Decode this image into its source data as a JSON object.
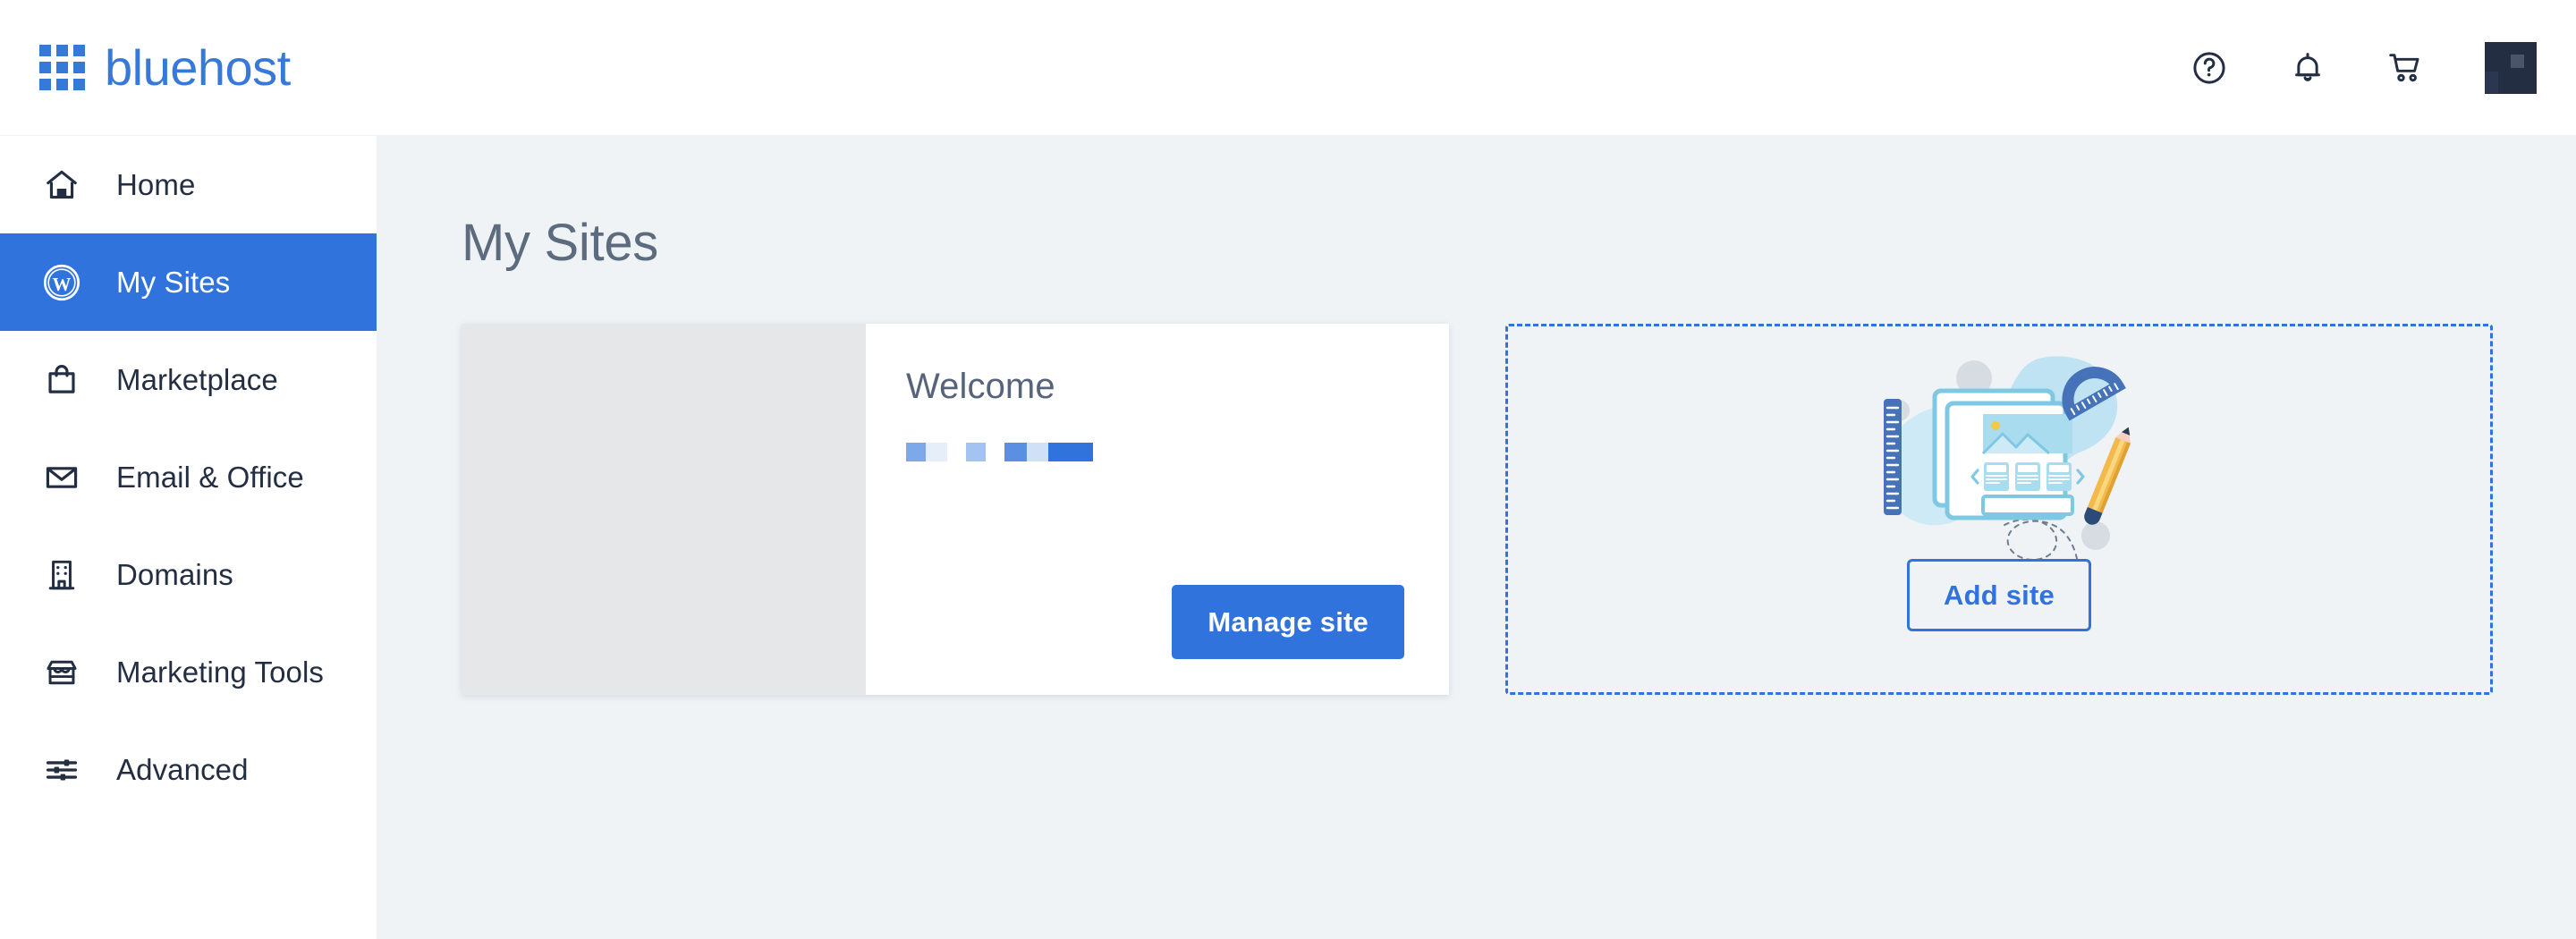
{
  "header": {
    "brand_name": "bluehost",
    "logo_icon": "grid-logo-icon",
    "logo_color": "#3679d8",
    "actions": [
      {
        "name": "help-icon",
        "label": "Help"
      },
      {
        "name": "notifications-bell-icon",
        "label": "Notifications"
      },
      {
        "name": "shopping-cart-icon",
        "label": "Cart"
      },
      {
        "name": "account-avatar",
        "label": "Account"
      }
    ]
  },
  "sidebar": {
    "active_item": "My Sites",
    "active_color": "#3073dc",
    "items": [
      {
        "label": "Home",
        "icon": "home-icon",
        "active": false
      },
      {
        "label": "My Sites",
        "icon": "wordpress-icon",
        "active": true
      },
      {
        "label": "Marketplace",
        "icon": "shopping-bag-icon",
        "active": false
      },
      {
        "label": "Email & Office",
        "icon": "envelope-icon",
        "active": false
      },
      {
        "label": "Domains",
        "icon": "building-icon",
        "active": false
      },
      {
        "label": "Marketing Tools",
        "icon": "storefront-icon",
        "active": false
      },
      {
        "label": "Advanced",
        "icon": "sliders-icon",
        "active": false
      }
    ]
  },
  "main": {
    "page_title": "My Sites",
    "background_color": "#eff3f6",
    "site_card": {
      "thumbnail": "site-screenshot-placeholder",
      "thumbnail_color": "#e5e7e8",
      "name": "Welcome",
      "loading_blocks": [
        {
          "width": 22,
          "color": "#7da9ea"
        },
        {
          "width": 24,
          "color": "#e6eff9"
        },
        {
          "width": 21,
          "color": "#ffffff"
        },
        {
          "width": 22,
          "color": "#a3c3f1"
        },
        {
          "width": 21,
          "color": "#ffffff"
        },
        {
          "width": 25,
          "color": "#5b8fe2"
        },
        {
          "width": 24,
          "color": "#cfe0f7"
        },
        {
          "width": 50,
          "color": "#3073dc"
        }
      ],
      "manage_button": "Manage site"
    },
    "add_site_panel": {
      "illustration": "website-builder-illustration",
      "border_color": "#3073dc",
      "add_button": "Add site"
    }
  }
}
